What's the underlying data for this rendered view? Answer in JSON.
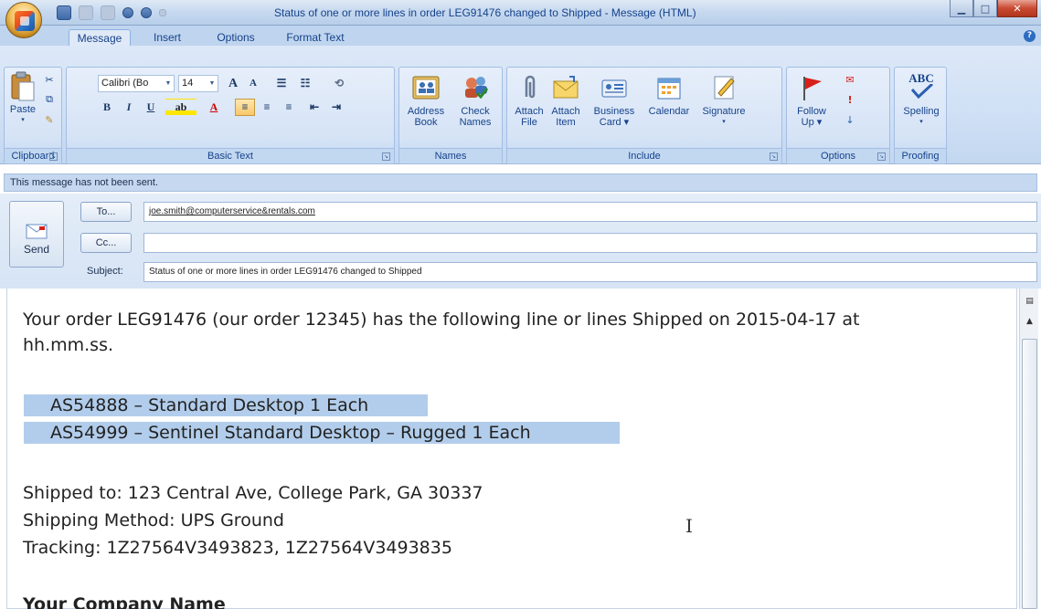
{
  "window": {
    "title": "Status of one or more lines in order LEG91476 changed to Shipped - Message (HTML)"
  },
  "tabs": [
    "Message",
    "Insert",
    "Options",
    "Format Text"
  ],
  "ribbon": {
    "clipboard": {
      "label": "Clipboard",
      "paste": "Paste"
    },
    "basic_text": {
      "label": "Basic Text",
      "font": "Calibri (Bo",
      "size": "14"
    },
    "names": {
      "label": "Names",
      "address_book_1": "Address",
      "address_book_2": "Book",
      "check_names_1": "Check",
      "check_names_2": "Names"
    },
    "include": {
      "label": "Include",
      "attach_file_1": "Attach",
      "attach_file_2": "File",
      "attach_item_1": "Attach",
      "attach_item_2": "Item",
      "business_card_1": "Business",
      "business_card_2": "Card ▾",
      "calendar": "Calendar",
      "signature": "Signature"
    },
    "options": {
      "label": "Options",
      "follow_up_1": "Follow",
      "follow_up_2": "Up ▾"
    },
    "proofing": {
      "label": "Proofing",
      "spelling": "Spelling",
      "abc": "ABC"
    }
  },
  "infobar": "This message has not been sent.",
  "header": {
    "send": "Send",
    "to_button": "To...",
    "cc_button": "Cc...",
    "subject_label": "Subject:",
    "to_value": "joe.smith@computerservice&rentals.com",
    "cc_value": "",
    "subject_value": "Status of one or more lines in order LEG91476 changed to Shipped"
  },
  "body": {
    "intro_1": "Your order LEG91476 (our order 12345) has the following line or lines Shipped on 2015-04-17  at",
    "intro_2": "hh.mm.ss.",
    "line_1": "AS54888 – Standard Desktop    1 Each",
    "line_2": "AS54999 – Sentinel Standard Desktop – Rugged       1 Each",
    "shipped_to": "Shipped to:  123 Central Ave, College Park, GA 30337",
    "shipping_method": "Shipping Method:  UPS Ground",
    "tracking": "Tracking: 1Z27564V3493823, 1Z27564V3493835",
    "company": "Your Company Name"
  },
  "colors": {
    "ribbon": "#cfe0f5",
    "highlight": "#b2cdeb",
    "title_text": "#15428b"
  }
}
